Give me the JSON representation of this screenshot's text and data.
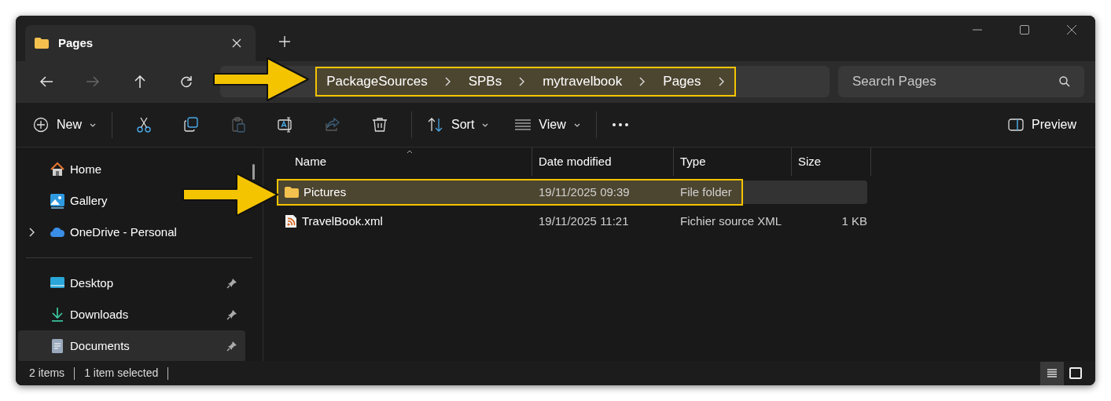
{
  "window": {
    "tab": {
      "title": "Pages",
      "selected": true
    }
  },
  "nav": [
    {
      "disabled": false
    },
    {
      "disabled": true
    },
    {
      "disabled": false
    },
    {
      "disabled": false
    }
  ],
  "address": {
    "breadcrumb": [
      "PackageSources",
      "SPBs",
      "mytravelbook",
      "Pages"
    ],
    "highlighted": true
  },
  "search": {
    "placeholder": "Search Pages"
  },
  "toolbar": {
    "new": {
      "label": "New"
    },
    "actions": [
      {
        "disabled": false
      },
      {
        "disabled": false
      },
      {
        "disabled": true
      },
      {
        "disabled": false
      },
      {
        "disabled": true
      },
      {
        "disabled": false
      }
    ],
    "sort": {
      "label": "Sort"
    },
    "view": {
      "label": "View"
    },
    "preview": {
      "label": "Preview"
    }
  },
  "sidebar": {
    "groups": [
      [
        {
          "label": "Home",
          "expandable": false,
          "pinned": false,
          "selected": false
        },
        {
          "label": "Gallery",
          "expandable": false,
          "pinned": false,
          "selected": false
        },
        {
          "label": "OneDrive - Personal",
          "expandable": true,
          "pinned": false,
          "selected": false
        }
      ],
      [
        {
          "label": "Desktop",
          "expandable": false,
          "pinned": true,
          "selected": false
        },
        {
          "label": "Downloads",
          "expandable": false,
          "pinned": true,
          "selected": false
        },
        {
          "label": "Documents",
          "expandable": false,
          "pinned": true,
          "selected": true
        }
      ]
    ]
  },
  "table": {
    "columns": [
      "Name",
      "Date modified",
      "Type",
      "Size"
    ],
    "rows": [
      {
        "kind": "folder",
        "name": "Pictures",
        "date": "19/11/2025 09:39",
        "type": "File folder",
        "selected": true,
        "highlighted": true
      },
      {
        "kind": "file",
        "name": "TravelBook.xml",
        "date": "19/11/2025 11:21",
        "type": "Fichier source XML",
        "size": "1 KB",
        "selected": false,
        "highlighted": false
      }
    ]
  },
  "status_bar": {
    "count": "2 items",
    "selection": "1 item selected"
  },
  "view_modes": [
    {
      "selected": true
    },
    {
      "selected": false
    }
  ],
  "annotations": [
    {
      "kind": "arrow"
    },
    {
      "kind": "arrow"
    }
  ]
}
